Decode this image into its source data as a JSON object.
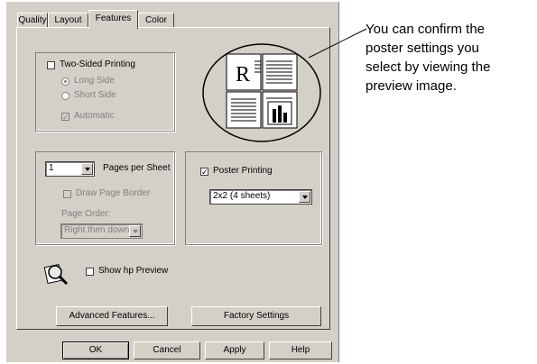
{
  "tabs": [
    "Quality",
    "Layout",
    "Features",
    "Color"
  ],
  "two_sided": {
    "label": "Two-Sided Printing",
    "checked": false,
    "long_side": "Long Side",
    "short_side": "Short Side",
    "automatic": "Automatic"
  },
  "pages_per_sheet": {
    "value": "1",
    "label": "Pages per Sheet",
    "draw_border": "Draw Page Border",
    "page_order_label": "Page Order:",
    "page_order_value": "Right then down"
  },
  "poster": {
    "label": "Poster Printing",
    "checked": true,
    "value": "2x2 (4 sheets)"
  },
  "show_preview": "Show hp Preview",
  "buttons": {
    "advanced": "Advanced Features...",
    "factory": "Factory Settings",
    "ok": "OK",
    "cancel": "Cancel",
    "apply": "Apply",
    "help": "Help"
  },
  "callout": {
    "line1": "You can confirm the",
    "line2": "poster settings you",
    "line3": "select by viewing the",
    "line4": "preview image."
  },
  "colors": {
    "dialog": "#d4d0c8"
  }
}
